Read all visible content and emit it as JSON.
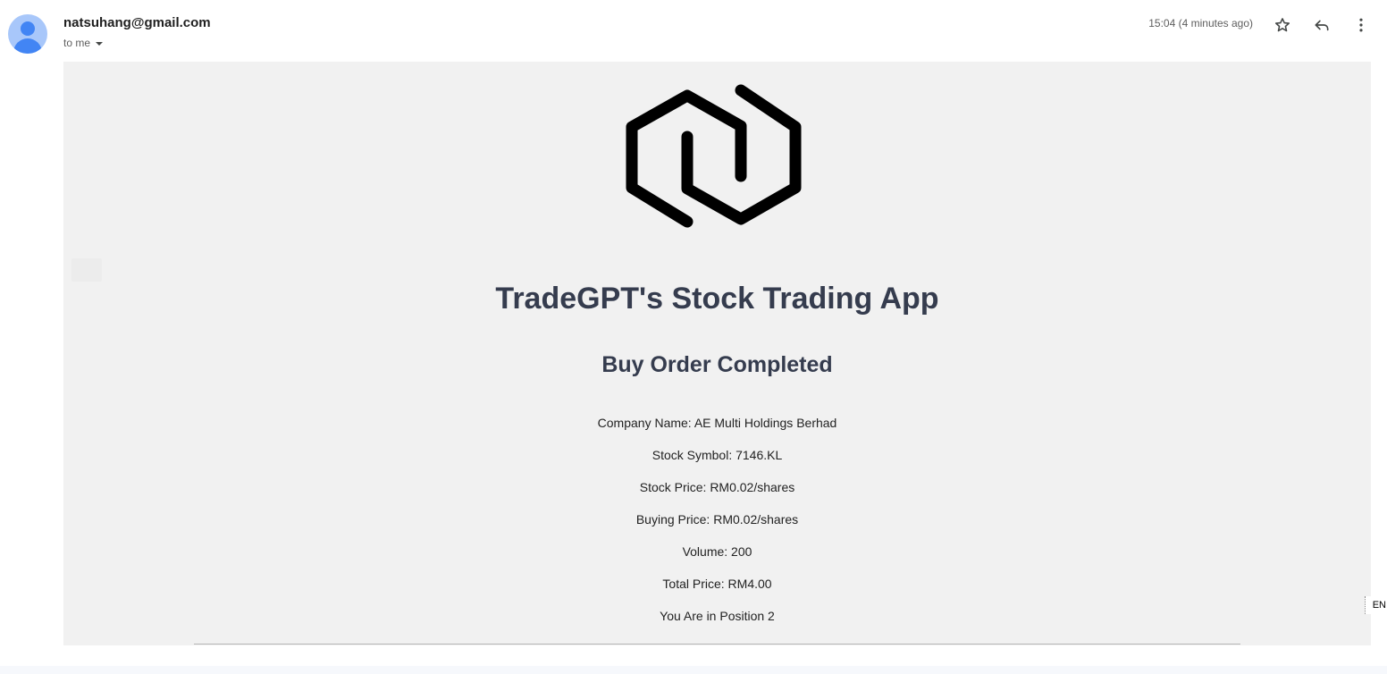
{
  "header": {
    "sender": "natsuhang@gmail.com",
    "recipient_label": "to me",
    "timestamp": "15:04 (4 minutes ago)",
    "icons": {
      "avatar": "person-avatar-icon",
      "recipient_toggle": "chevron-down-icon",
      "star": "star-outline-icon",
      "reply": "reply-icon",
      "more": "more-vertical-icon"
    }
  },
  "email": {
    "logo_icon": "hexagon-link-logo-icon",
    "app_title": "TradeGPT's Stock Trading App",
    "order_title": "Buy Order Completed",
    "details": [
      "Company Name: AE Multi Holdings Berhad",
      "Stock Symbol: 7146.KL",
      "Stock Price: RM0.02/shares",
      "Buying Price: RM0.02/shares",
      "Volume: 200",
      "Total Price: RM4.00",
      "You Are in Position 2"
    ]
  },
  "language_indicator": "EN",
  "colors": {
    "email_background": "#f1f1f1",
    "title_color": "#353c4e",
    "avatar_background": "#a8c7fa",
    "avatar_figure": "#4285f4"
  }
}
